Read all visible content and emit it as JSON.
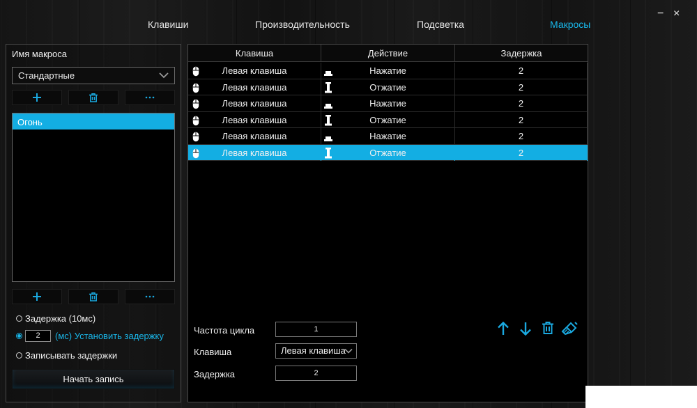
{
  "nav": {
    "tabs": [
      {
        "label": "Клавиши",
        "active": false
      },
      {
        "label": "Производительность",
        "active": false
      },
      {
        "label": "Подсветка",
        "active": false
      },
      {
        "label": "Макросы",
        "active": true
      }
    ],
    "minimize": "−",
    "close": "×"
  },
  "left": {
    "macro_name_label": "Имя макроса",
    "profile_select": "Стандартные",
    "macros": [
      {
        "label": "Огонь",
        "selected": true
      }
    ],
    "toolbar_icons": [
      "plus-icon",
      "trash-icon",
      "more-icon"
    ],
    "options": {
      "delay_10ms": "Задержка (10мс)",
      "custom_delay_value": "2",
      "custom_delay_label": "(мс) Установить задержку",
      "record_delays": "Записывать задержки",
      "selected": "custom_delay"
    },
    "start_record": "Начать запись"
  },
  "table": {
    "headers": [
      "Клавиша",
      "Действие",
      "Задержка"
    ],
    "rows": [
      {
        "key": "Левая клавиша",
        "action": "Нажатие",
        "delay": "2",
        "action_icon": "key-press-icon"
      },
      {
        "key": "Левая клавиша",
        "action": "Отжатие",
        "delay": "2",
        "action_icon": "key-release-icon"
      },
      {
        "key": "Левая клавиша",
        "action": "Нажатие",
        "delay": "2",
        "action_icon": "key-press-icon"
      },
      {
        "key": "Левая клавиша",
        "action": "Отжатие",
        "delay": "2",
        "action_icon": "key-release-icon"
      },
      {
        "key": "Левая клавиша",
        "action": "Нажатие",
        "delay": "2",
        "action_icon": "key-press-icon"
      },
      {
        "key": "Левая клавиша",
        "action": "Отжатие",
        "delay": "2",
        "action_icon": "key-release-icon",
        "selected": true
      }
    ]
  },
  "editor": {
    "cycle_label": "Частота цикла",
    "cycle_value": "1",
    "key_label": "Клавиша",
    "key_value": "Левая клавиша",
    "delay_label": "Задержка",
    "delay_value": "2",
    "tools": [
      "arrow-up-icon",
      "arrow-down-icon",
      "trash-icon",
      "clear-brush-icon"
    ]
  },
  "colors": {
    "accent": "#13aee3",
    "background": "#161616"
  }
}
